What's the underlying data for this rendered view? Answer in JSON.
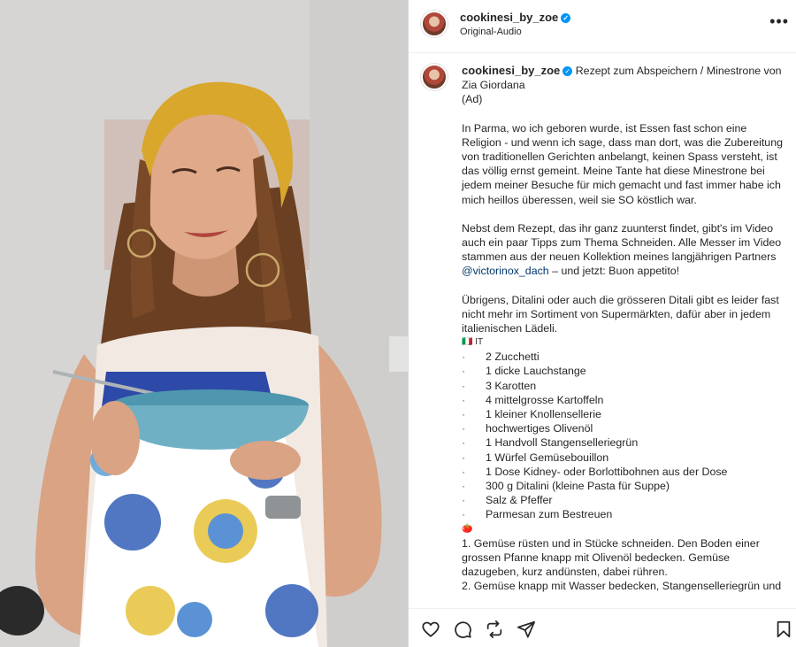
{
  "header": {
    "username": "cookinesi_by_zoe",
    "audio": "Original-Audio",
    "more_label": "•••"
  },
  "caption": {
    "username": "cookinesi_by_zoe",
    "title": "Rezept zum Abspeichern / Minestrone von Zia Giordana",
    "ad": "(Ad)",
    "para1": "In Parma, wo ich geboren wurde, ist Essen fast schon eine Religion - und wenn ich sage, dass man dort, was die Zubereitung von traditionellen Gerichten anbelangt, keinen Spass versteht, ist das völlig ernst gemeint. Meine Tante hat diese Minestrone bei jedem meiner Besuche für mich gemacht und fast immer habe ich mich heillos überessen, weil sie SO köstlich war.",
    "para2_a": "Nebst dem Rezept, das ihr ganz zuunterst findet, gibt's im Video auch ein paar Tipps zum Thema Schneiden. Alle Messer im Video stammen aus der neuen Kollektion meines langjährigen Partners ",
    "para2_mention": "@victorinox_dach",
    "para2_b": " – und jetzt: Buon appetito!",
    "para3": "Übrigens, Ditalini oder auch die grösseren Ditali gibt es leider fast nicht mehr im Sortiment von Supermärkten, dafür aber in jedem italienischen Lädeli.",
    "ing_marker": "🇮🇹 IT",
    "ingredients": [
      "2 Zucchetti",
      "1 dicke Lauchstange",
      "3 Karotten",
      "4 mittelgrosse Kartoffeln",
      "1 kleiner Knollensellerie",
      "hochwertiges Olivenöl",
      "1 Handvoll Stangenselleriegrün",
      "1 Würfel Gemüsebouillon",
      "1 Dose Kidney- oder Borlottibohnen aus der Dose",
      "300 g Ditalini (kleine Pasta für Suppe)",
      "Salz & Pfeffer",
      "Parmesan zum Bestreuen"
    ],
    "steps_marker": "🍅",
    "steps": [
      "1. Gemüse rüsten und in Stücke schneiden. Den Boden einer grossen Pfanne knapp mit Olivenöl bedecken. Gemüse dazugeben, kurz andünsten, dabei rühren.",
      "2. Gemüse knapp mit Wasser bedecken, Stangenselleriegrün und"
    ]
  },
  "actions": {
    "icons": [
      "heart-icon",
      "comment-icon",
      "repost-icon",
      "share-icon",
      "bookmark-icon"
    ]
  },
  "colors": {
    "verified": "#0095f6",
    "mention": "#00376b",
    "headband": "#d8a72c",
    "bowl": "#6fb0c4"
  }
}
